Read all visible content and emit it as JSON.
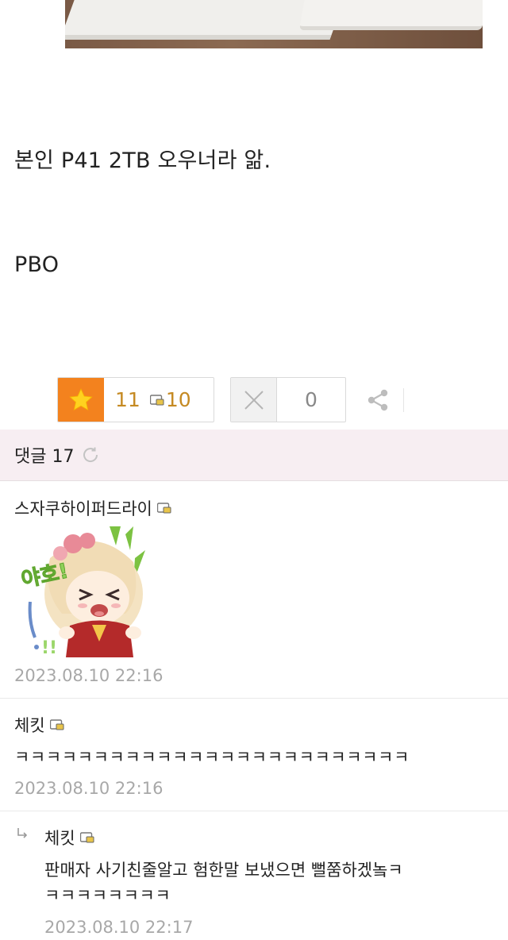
{
  "post": {
    "line1": "본인 P41 2TB 오우너라 앎.",
    "line2": "PBO"
  },
  "votes": {
    "like_count": "11",
    "fixed_count": "10",
    "dislike_count": "0"
  },
  "comments_header": {
    "label": "댓글 17"
  },
  "comments": [
    {
      "author": "스자쿠하이퍼드라이",
      "sticker_text": "야호!",
      "date": "2023.08.10 22:16"
    },
    {
      "author": "체킷",
      "text": "ㅋㅋㅋㅋㅋㅋㅋㅋㅋㅋㅋㅋㅋㅋㅋㅋㅋㅋㅋㅋㅋㅋㅋㅋㅋ",
      "date": "2023.08.10 22:16"
    },
    {
      "author": "체킷",
      "text_line1": "판매자 사기친줄알고 험한말 보냈으면 뻘쭘하겠놐ㅋ",
      "text_line2": "ㅋㅋㅋㅋㅋㅋㅋㅋ",
      "date": "2023.08.10 22:17",
      "is_reply": true
    }
  ],
  "colors": {
    "accent_orange": "#f3821e",
    "count_gold": "#c58a23",
    "comment_header_bg": "#f7eef2",
    "date_gray": "#a8a8a8"
  },
  "icons": [
    "star-icon",
    "fixed-user-icon",
    "close-x-icon",
    "share-icon",
    "refresh-icon",
    "reply-arrow-icon"
  ]
}
